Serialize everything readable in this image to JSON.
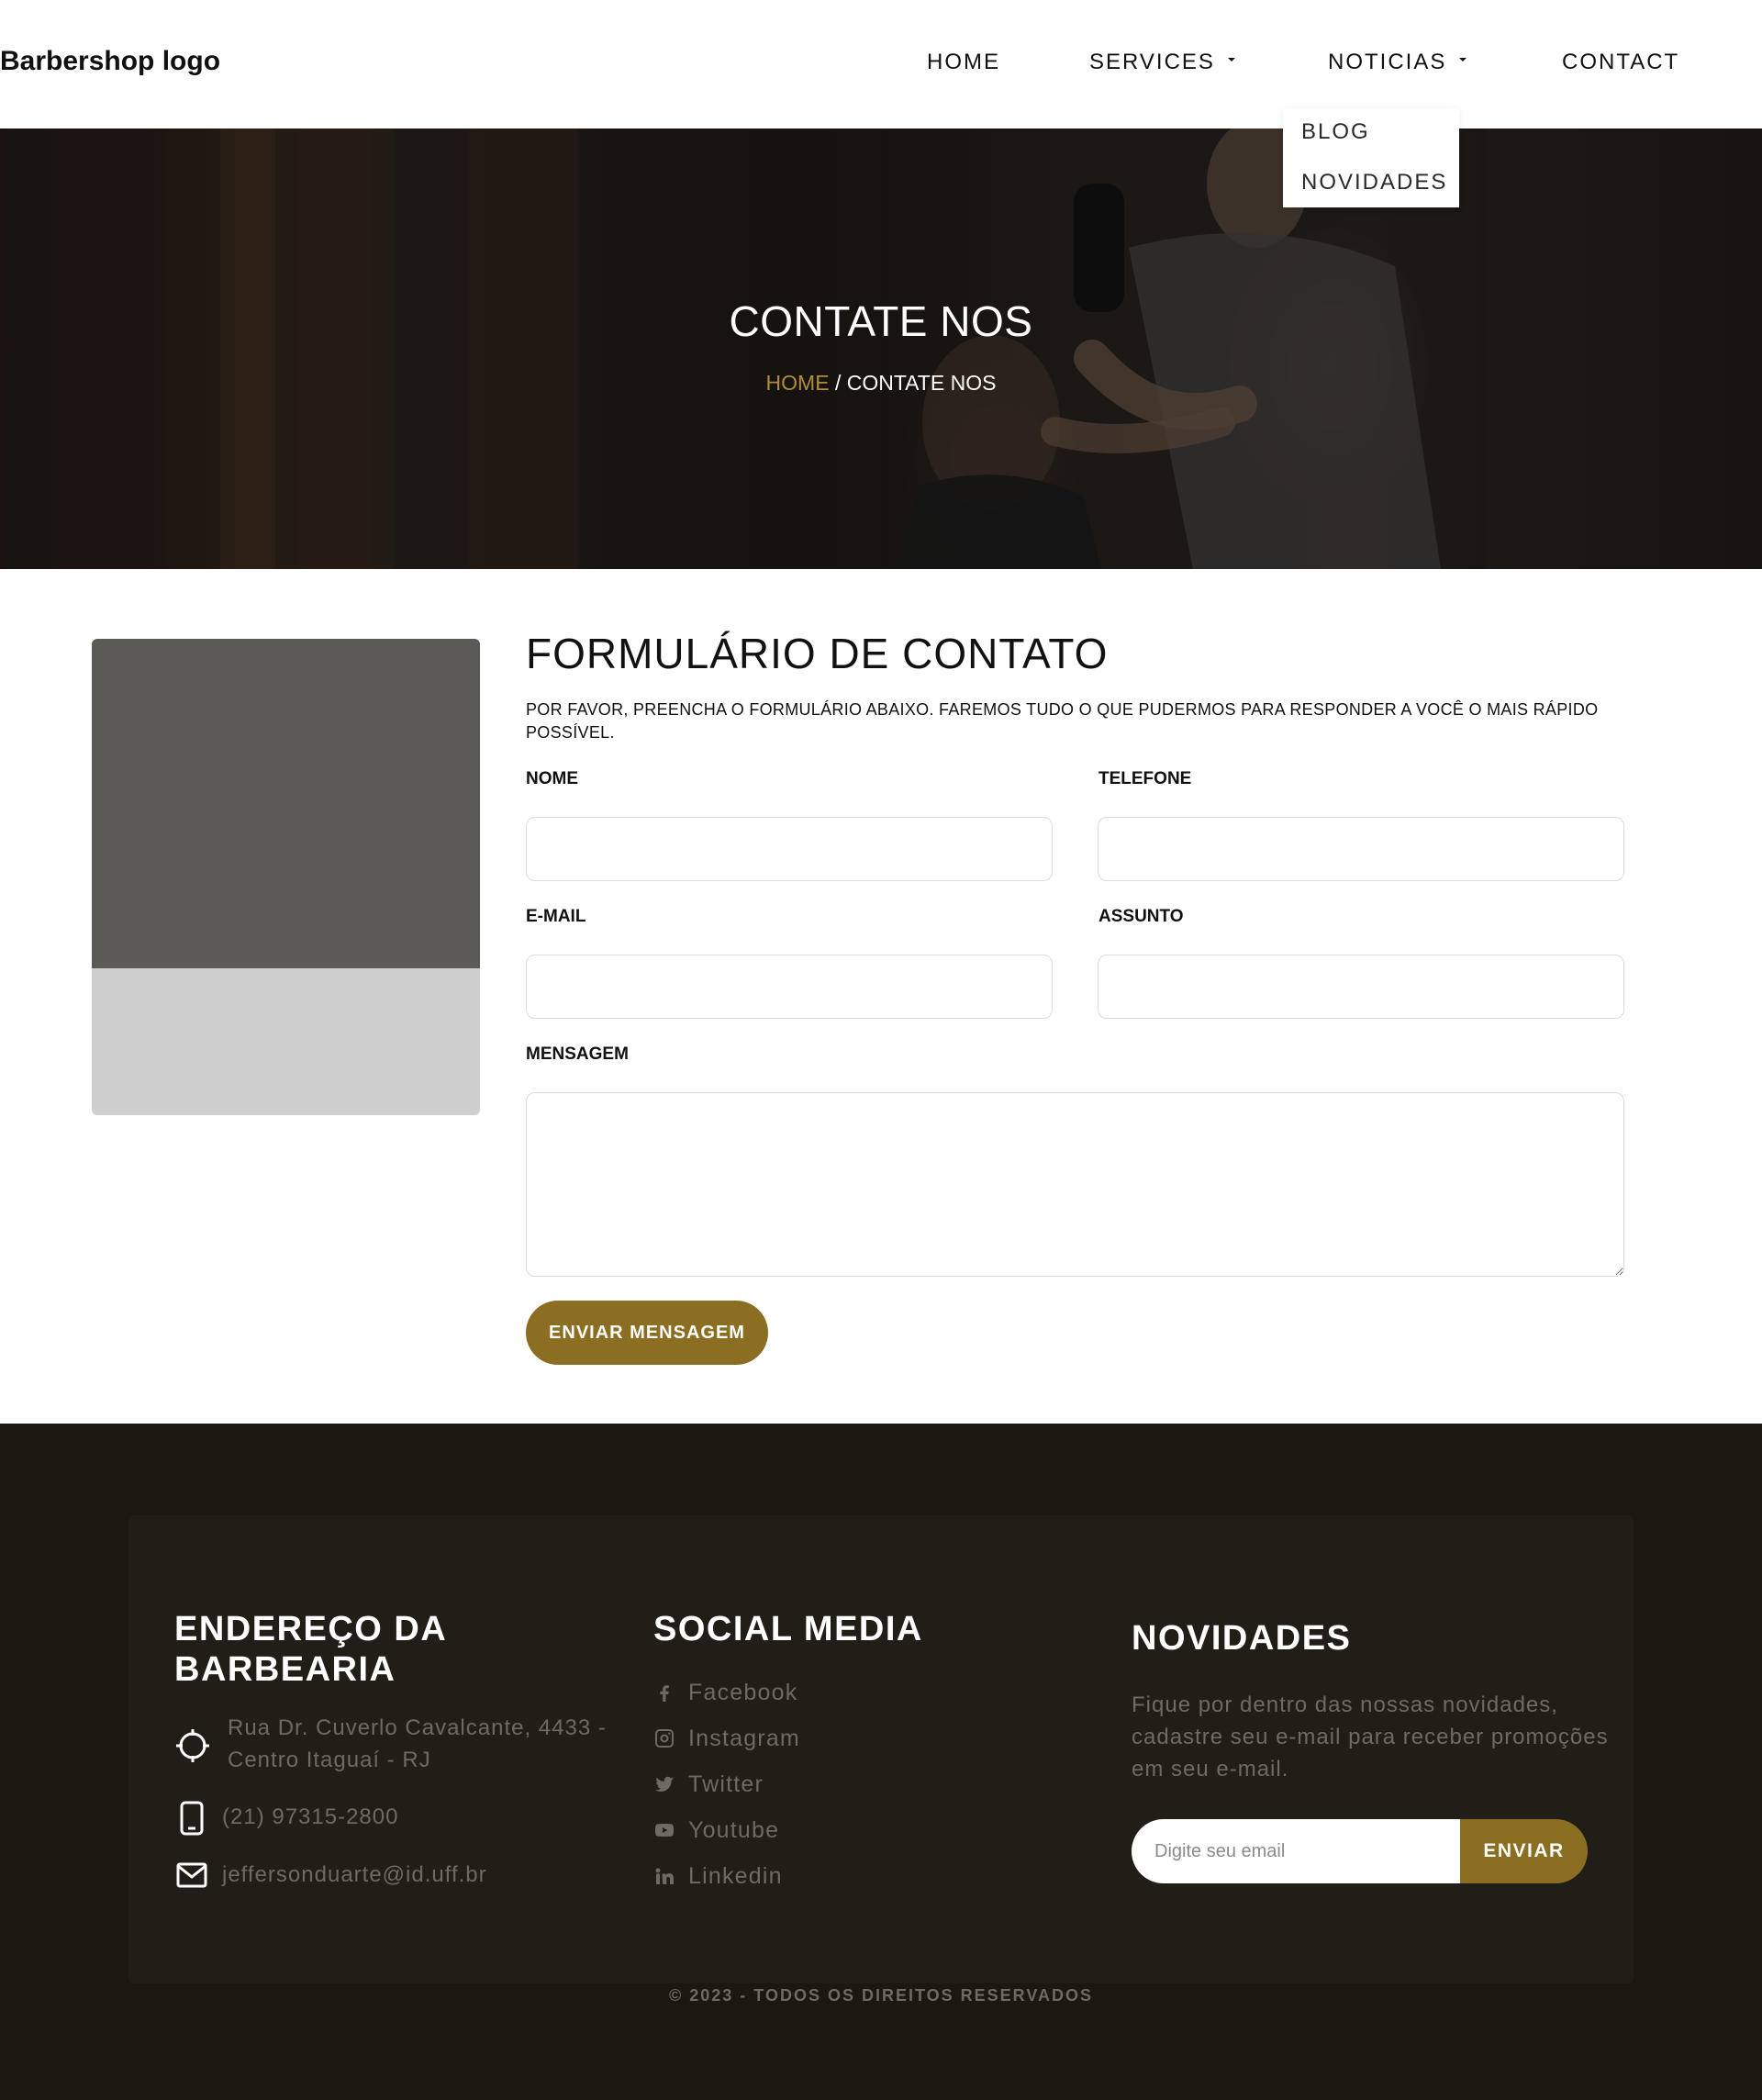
{
  "header": {
    "logo": "Barbershop logo",
    "nav": {
      "home": "HOME",
      "services": "SERVICES",
      "noticias": "NOTICIAS",
      "contact": "CONTACT"
    },
    "dropdown": [
      "BLOG",
      "NOVIDADES"
    ]
  },
  "hero": {
    "title": "CONTATE NOS",
    "breadcrumb_home": "HOME",
    "breadcrumb_separator": "/",
    "breadcrumb_current": "CONTATE NOS"
  },
  "form": {
    "title": "FORMULÁRIO DE CONTATO",
    "description": "POR FAVOR, PREENCHA O FORMULÁRIO ABAIXO. FAREMOS TUDO O QUE PUDERMOS PARA RESPONDER A VOCÊ O MAIS RÁPIDO POSSÍVEL.",
    "labels": {
      "nome": "NOME",
      "telefone": "TELEFONE",
      "email": "E-MAIL",
      "assunto": "ASSUNTO",
      "mensagem": "MENSAGEM"
    },
    "values": {
      "nome": "",
      "telefone": "",
      "email": "",
      "assunto": "",
      "mensagem": ""
    },
    "submit": "ENVIAR MENSAGEM"
  },
  "footer": {
    "address_heading_line1": "ENDEREÇO DA",
    "address_heading_line2": "BARBEARIA",
    "address_line1": "Rua Dr. Cuverlo Cavalcante, 4433 -",
    "address_line2": "Centro Itaguaí - RJ",
    "phone": "(21) 97315-2800",
    "email": "jeffersonduarte@id.uff.br",
    "social_heading": "SOCIAL MEDIA",
    "social": [
      {
        "label": "Facebook",
        "icon": "facebook-icon"
      },
      {
        "label": "Instagram",
        "icon": "instagram-icon"
      },
      {
        "label": "Twitter",
        "icon": "twitter-icon"
      },
      {
        "label": "Youtube",
        "icon": "youtube-icon"
      },
      {
        "label": "Linkedin",
        "icon": "linkedin-icon"
      }
    ],
    "news_heading": "NOVIDADES",
    "news_line1": "Fique por dentro das nossas novidades,",
    "news_line2": "cadastre seu e-mail para receber promoções",
    "news_line3": "em seu e-mail.",
    "newsletter_placeholder": "Digite seu email",
    "newsletter_button": "ENVIAR",
    "copyright": "© 2023 - TODOS OS DIREITOS RESERVADOS"
  },
  "colors": {
    "accent": "#8b6e22",
    "breadcrumb_home": "#b08d3a",
    "footer_bg": "#1b1811",
    "footer_card": "#211e18",
    "footer_text": "#6f6b63"
  }
}
